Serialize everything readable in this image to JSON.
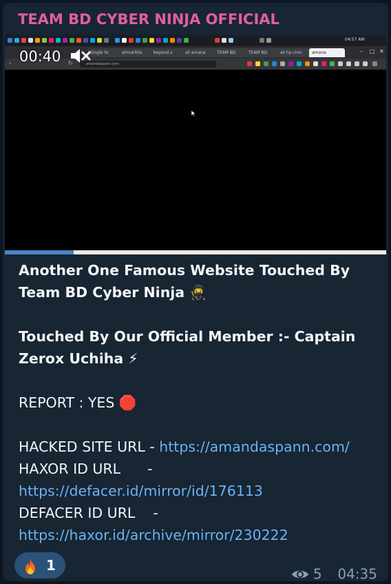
{
  "channel": {
    "name": "TEAM BD CYBER NINJA OFFICIAL",
    "name_color": "#e0609a"
  },
  "video": {
    "timer": "00:40",
    "muted": true,
    "progress_fraction": 0.18,
    "browser_url": "amandaspann.com",
    "tabs": [
      "Single hc",
      "almukhtis",
      "beyond.s",
      "ali amana",
      "TEAM BD",
      "TEAM BD",
      "ali hp.chm",
      "amana"
    ],
    "taskbar_clock": "04:57 AM"
  },
  "message": {
    "headline_1": "Another One Famous  Website Touched By",
    "headline_2": "Team BD Cyber Ninja 🥷",
    "member_1": "Touched By Our Official Member :- Captain",
    "member_2": "Zerox Uchiha ⚡",
    "report": "REPORT : YES 🛑",
    "hacked_label": "HACKED SITE URL - ",
    "hacked_url": "https://amandaspann.com/",
    "haxor_label": "HAXOR ID URL      -",
    "haxor_url": "https://defacer.id/mirror/id/176113",
    "defacer_label": "DEFACER ID URL    -",
    "defacer_url": "https://haxor.id/archive/mirror/230222"
  },
  "reaction": {
    "emoji": "fire-icon",
    "count": "1"
  },
  "footer": {
    "views": "5",
    "time": "04:35"
  },
  "colors": {
    "bubble": "#182533",
    "link": "#6ab3f3",
    "reaction_bg": "#2b5278",
    "meta": "#8b9eb1"
  }
}
